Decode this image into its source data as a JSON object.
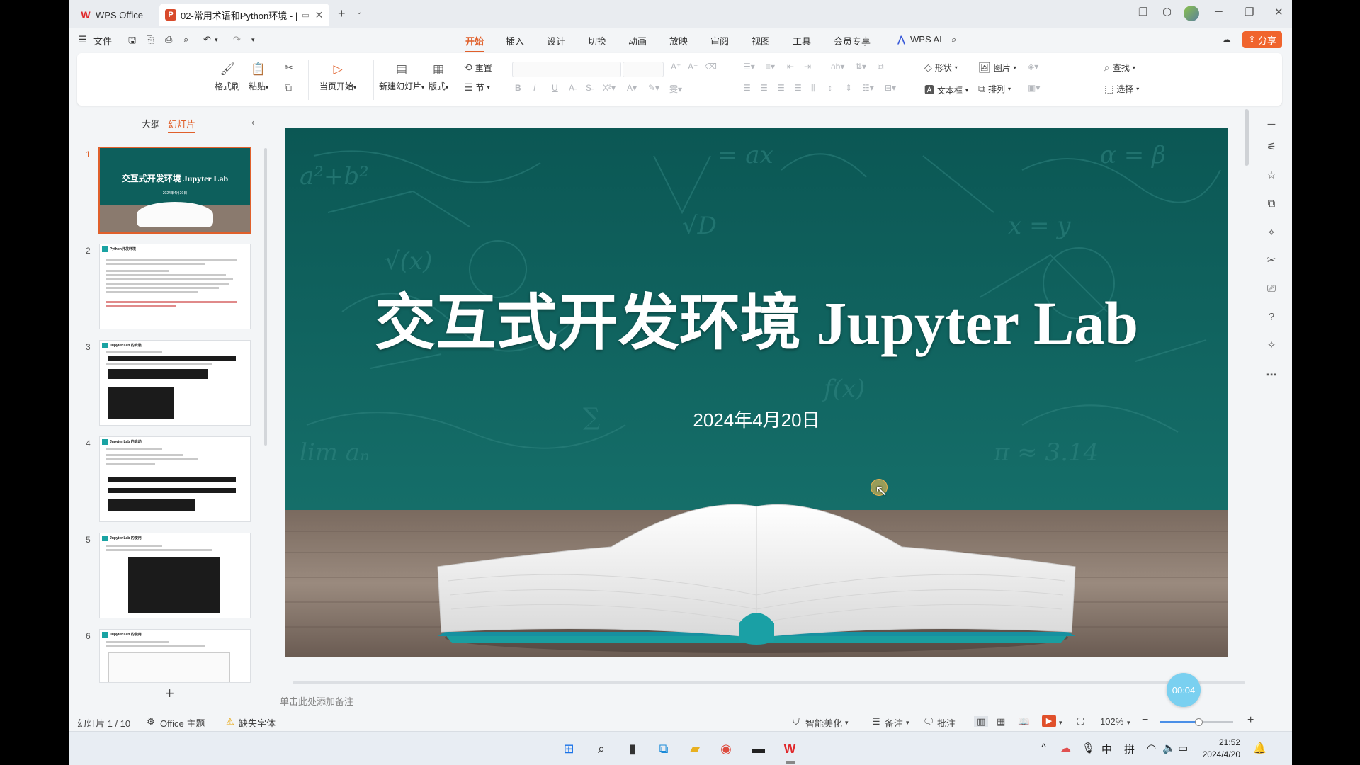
{
  "titlebar": {
    "app_tab": "WPS Office",
    "doc_tab": "02-常用术语和Python环境 - |",
    "new_tab": "+"
  },
  "menu": {
    "file": "文件",
    "tabs": [
      "开始",
      "插入",
      "设计",
      "切换",
      "动画",
      "放映",
      "审阅",
      "视图",
      "工具",
      "会员专享"
    ],
    "ai": "WPS AI",
    "share": "分享"
  },
  "ribbon": {
    "format_painter": "格式刷",
    "paste": "粘贴",
    "from_current": "当页开始",
    "new_slide": "新建幻灯片",
    "layout": "版式",
    "reset": "重置",
    "section": "节",
    "shape": "形状",
    "picture": "图片",
    "find": "查找",
    "textbox": "文本框",
    "arrange": "排列",
    "select": "选择"
  },
  "panel": {
    "outline_tab": "大纲",
    "slides_tab": "幻灯片",
    "thumbs": [
      {
        "num": "1",
        "title": "交互式开发环境 Jupyter Lab",
        "date": "2024年4月20日"
      },
      {
        "num": "2",
        "title": "Python开发环境"
      },
      {
        "num": "3",
        "title": "Jupyter Lab 的安装"
      },
      {
        "num": "4",
        "title": "Jupyter Lab 的启动"
      },
      {
        "num": "5",
        "title": "Jupyter Lab 的使用"
      },
      {
        "num": "6",
        "title": "Jupyter Lab 的使用"
      }
    ],
    "add": "+"
  },
  "slide": {
    "title": "交互式开发环境 Jupyter Lab",
    "date": "2024年4月20日"
  },
  "notes_placeholder": "单击此处添加备注",
  "timer": "00:04",
  "status": {
    "slide_count": "幻灯片 1 / 10",
    "theme": "Office 主题",
    "missing_font": "缺失字体",
    "beautify": "智能美化",
    "notes": "备注",
    "comments": "批注",
    "zoom": "102%"
  },
  "tray": {
    "ime_lang": "中",
    "ime_mode": "拼",
    "time": "21:52",
    "date": "2024/4/20"
  },
  "colors": {
    "accent": "#e0602b",
    "slide_bg": "#0d5f5c",
    "share_bg": "#f0642d"
  }
}
